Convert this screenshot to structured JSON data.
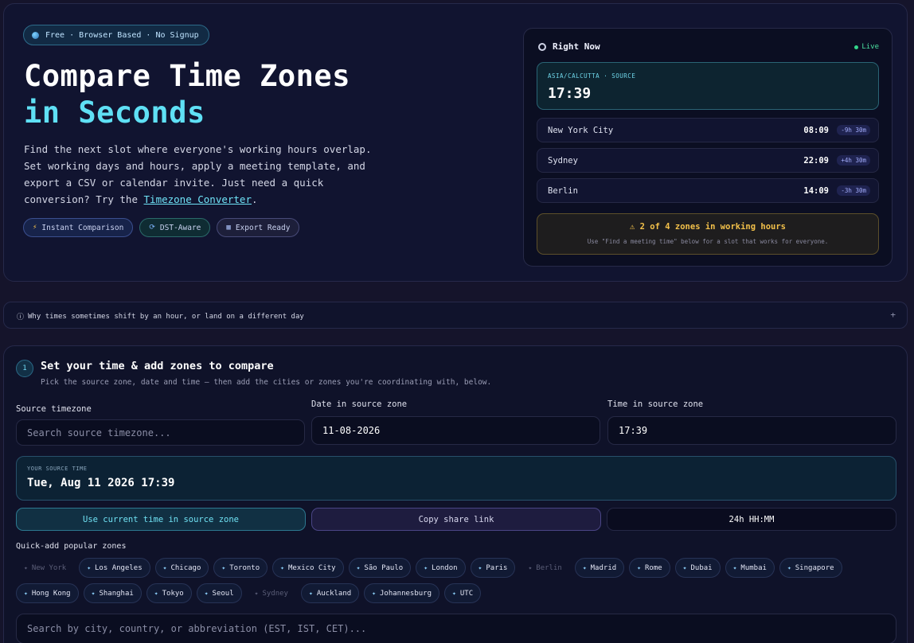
{
  "hero": {
    "pill": "Free · Browser Based · No Signup",
    "title_line1": "Compare Time Zones",
    "title_line2": "in Seconds",
    "desc_text": "Find the next slot where everyone's working hours overlap. Set working days and hours, apply a meeting template, and export a CSV or calendar invite. Just need a quick conversion? Try the ",
    "desc_link": "Timezone Converter",
    "desc_end": ".",
    "tags": [
      "Instant Comparison",
      "DST-Aware",
      "Export Ready"
    ]
  },
  "right_now": {
    "title": "Right Now",
    "live": "Live",
    "source_label": "ASIA/CALCUTTA · SOURCE",
    "source_time": "17:39",
    "cities": [
      {
        "name": "New York City",
        "time": "08:09",
        "diff": "-9h 30m"
      },
      {
        "name": "Sydney",
        "time": "22:09",
        "diff": "+4h 30m"
      },
      {
        "name": "Berlin",
        "time": "14:09",
        "diff": "-3h 30m"
      }
    ],
    "warning_title": "2 of 4 zones in working hours",
    "warning_sub": "Use \"Find a meeting time\" below for a slot that works for everyone."
  },
  "why_bar": {
    "label": "Why times sometimes shift by an hour, or land on a different day",
    "toggle": "+"
  },
  "step": {
    "number": "1",
    "title": "Set your time & add zones to compare",
    "subtitle": "Pick the source zone, date and time — then add the cities or zones you're coordinating with, below.",
    "source_tz_label": "Source timezone",
    "source_tz_placeholder": "Search source timezone...",
    "date_label": "Date in source zone",
    "date_value": "11-08-2026",
    "time_label": "Time in source zone",
    "time_value": "17:39",
    "your_source_label": "YOUR SOURCE TIME",
    "your_source_value": "Tue, Aug 11 2026 17:39",
    "btn_current": "Use current time in source zone",
    "btn_share": "Copy share link",
    "btn_format": "24h HH:MM",
    "quick_add_label": "Quick-add popular zones",
    "quick_row1": [
      {
        "label": "New York",
        "added": true
      },
      {
        "label": "Los Angeles",
        "added": false
      },
      {
        "label": "Chicago",
        "added": false
      },
      {
        "label": "Toronto",
        "added": false
      },
      {
        "label": "Mexico City",
        "added": false
      },
      {
        "label": "São Paulo",
        "added": false
      },
      {
        "label": "London",
        "added": false
      },
      {
        "label": "Paris",
        "added": false
      },
      {
        "label": "Berlin",
        "added": true
      },
      {
        "label": "Madrid",
        "added": false
      },
      {
        "label": "Rome",
        "added": false
      },
      {
        "label": "Dubai",
        "added": false
      },
      {
        "label": "Mumbai",
        "added": false
      },
      {
        "label": "Singapore",
        "added": false
      }
    ],
    "quick_row2": [
      {
        "label": "Hong Kong",
        "added": false
      },
      {
        "label": "Shanghai",
        "added": false
      },
      {
        "label": "Tokyo",
        "added": false
      },
      {
        "label": "Seoul",
        "added": false
      },
      {
        "label": "Sydney",
        "added": true
      },
      {
        "label": "Auckland",
        "added": false
      },
      {
        "label": "Johannesburg",
        "added": false
      },
      {
        "label": "UTC",
        "added": false
      }
    ],
    "search_placeholder": "Search by city, country, or abbreviation (EST, IST, CET)..."
  }
}
